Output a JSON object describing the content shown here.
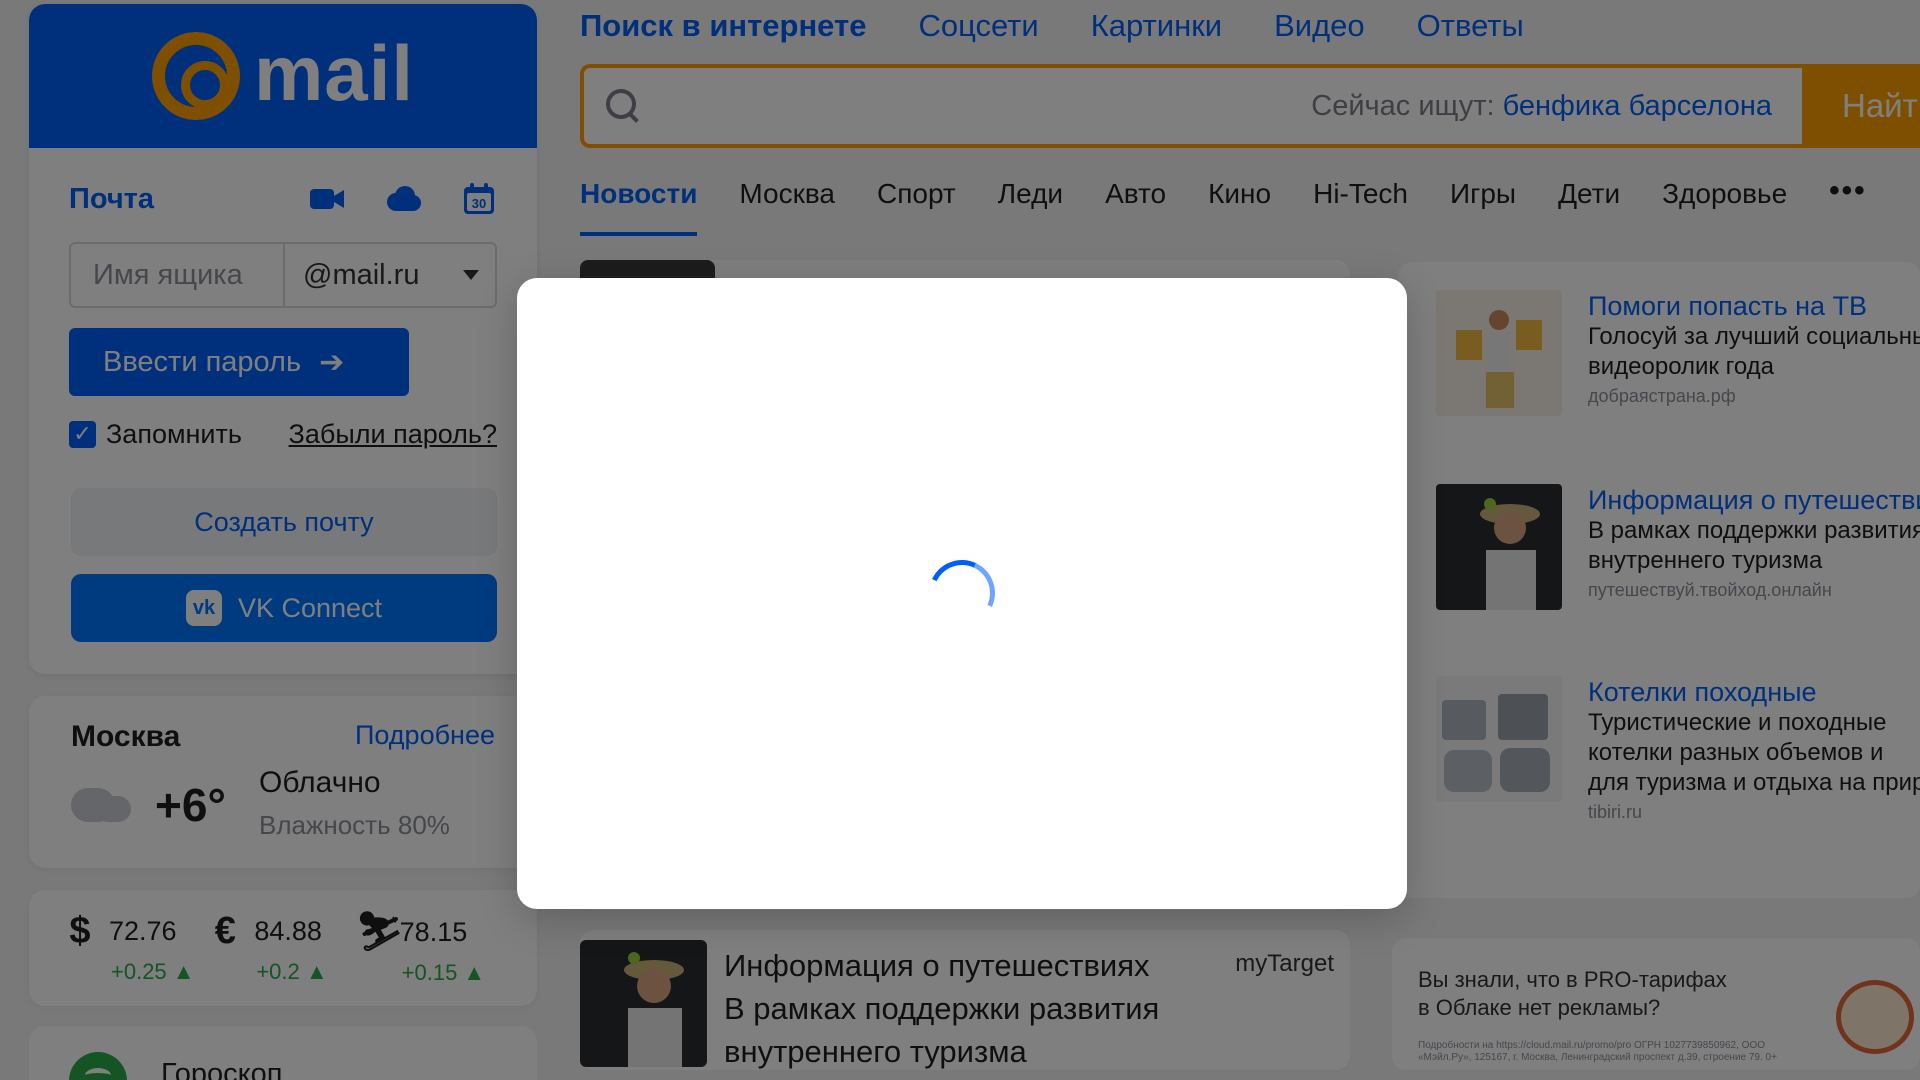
{
  "logo": {
    "text": "mail"
  },
  "mailbox": {
    "title": "Почта",
    "icons": [
      "video-camera-icon",
      "cloud-icon",
      "calendar-icon"
    ],
    "calendar_day": "30",
    "login_placeholder": "Имя ящика",
    "domain": "@mail.ru",
    "password_button": "Ввести пароль",
    "password_arrow": "➔",
    "remember_label": "Запомнить",
    "forgot_link": "Забыли пароль?",
    "create_button": "Создать почту",
    "vk_button": "VK Connect",
    "vk_logo": "vk"
  },
  "weather": {
    "city": "Москва",
    "more_link": "Подробнее",
    "temperature": "+6°",
    "condition": "Облачно",
    "humidity": "Влажность 80%"
  },
  "rates": [
    {
      "symbol": "$",
      "icon": "dollar-icon",
      "value": "72.76",
      "delta": "+0.25 ▲"
    },
    {
      "symbol": "€",
      "icon": "euro-icon",
      "value": "84.88",
      "delta": "+0.2 ▲"
    },
    {
      "symbol": "⛷",
      "icon": "oil-icon",
      "value": "78.15",
      "delta": "+0.15 ▲"
    }
  ],
  "horoscope": {
    "title": "Гороскоп"
  },
  "search": {
    "tabs": [
      "Поиск в интернете",
      "Соцсети",
      "Картинки",
      "Видео",
      "Ответы"
    ],
    "hint_prefix": "Сейчас ищут:",
    "hint_query": "бенфика барселона",
    "button": "Найти"
  },
  "news_tabs": [
    "Новости",
    "Москва",
    "Спорт",
    "Леди",
    "Авто",
    "Кино",
    "Hi-Tech",
    "Игры",
    "Дети",
    "Здоровье"
  ],
  "news_more": "•••",
  "ads": [
    {
      "title": "Помоги попасть на ТВ",
      "desc1": "Голосуй за лучший социальный",
      "desc2": "видеоролик года",
      "source": "добраястрана.рф"
    },
    {
      "title": "Информация о путешествиях",
      "desc1": "В рамках поддержки развития",
      "desc2": "внутреннего туризма",
      "source": "путешествуй.твойход.онлайн"
    },
    {
      "title": "Котелки походные",
      "desc1": "Туристические и походные",
      "desc2": "котелки разных объемов и",
      "desc3": "для туризма и отдыха на природе",
      "source": "tibiri.ru"
    }
  ],
  "bottom_news": {
    "line1": "Информация о путешествиях",
    "line2": "В рамках поддержки развития",
    "line3": "внутреннего туризма",
    "source": "myTarget"
  },
  "promo": {
    "line1": "Вы знали, что в PRO-тарифах",
    "line2": "в Облаке нет рекламы?",
    "fine1": "Подробности на https://cloud.mail.ru/promo/pro ОГРН 1027739850962, ООО",
    "fine2": "«Мэйл.Ру», 125167, г. Москва, Ленинградский проспект д.39, строение 79. 0+"
  },
  "colors": {
    "brand": "#005ff9",
    "accent": "#ff9e00",
    "positive": "#2aa84a"
  },
  "modal": {
    "state": "loading"
  }
}
